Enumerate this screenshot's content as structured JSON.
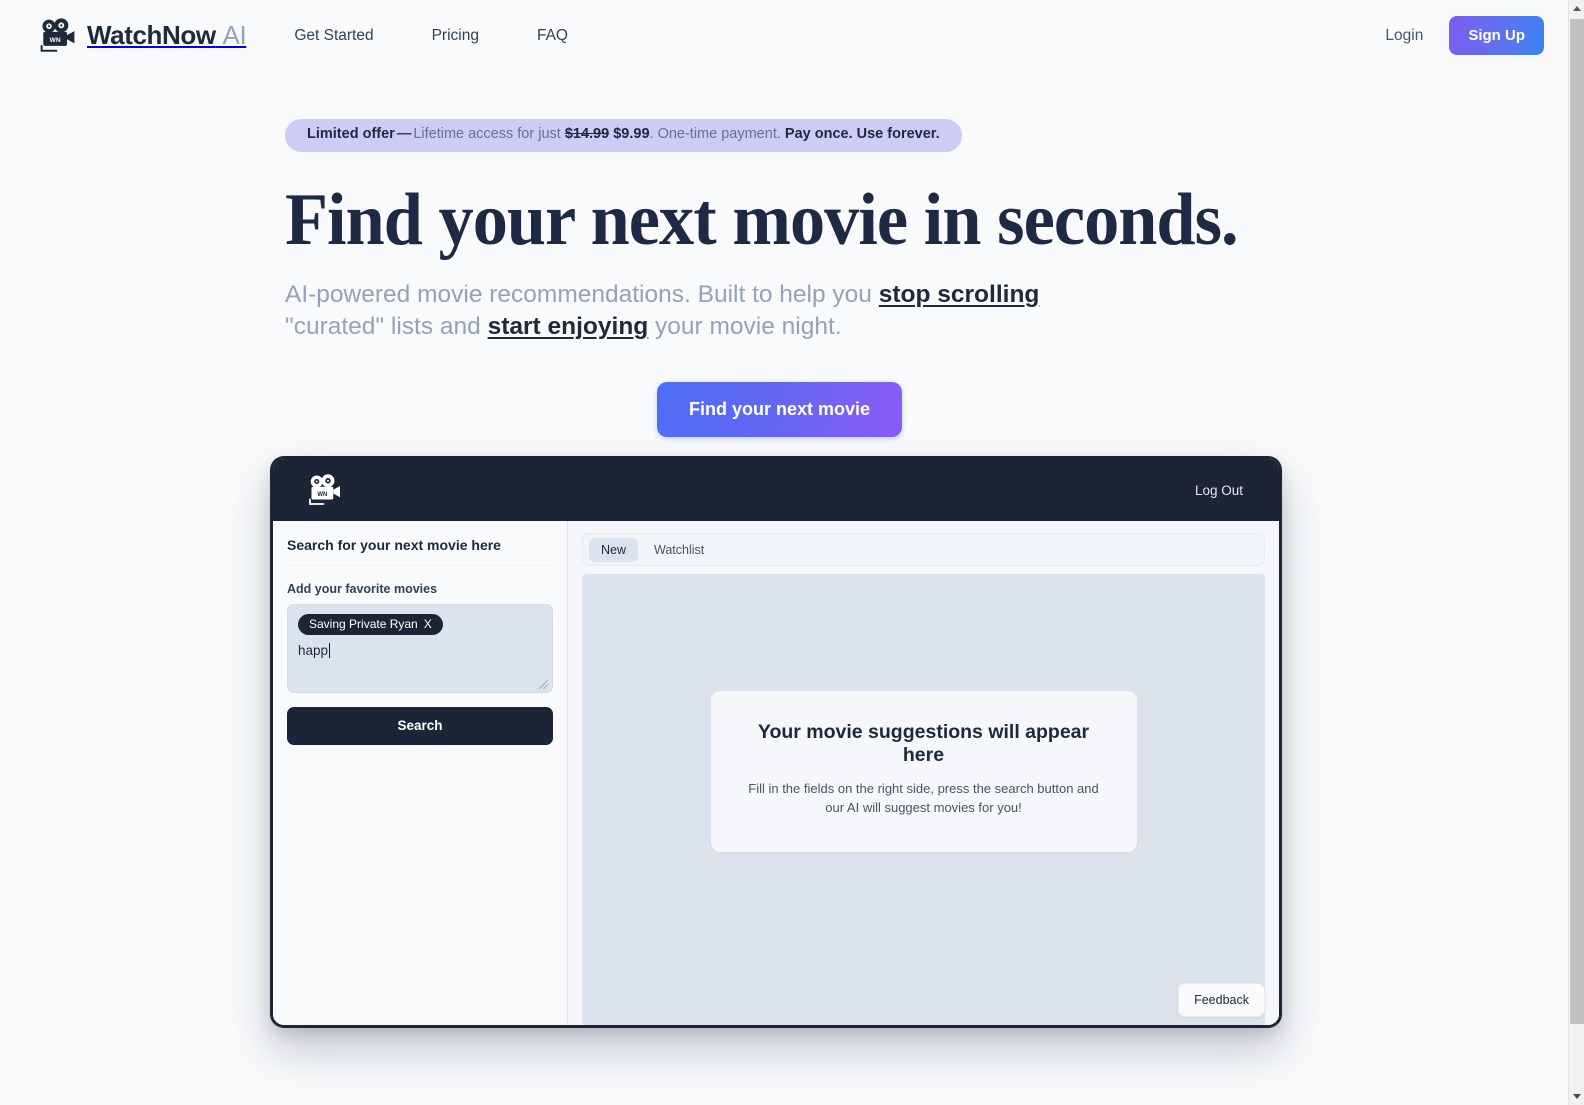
{
  "nav": {
    "brand_name": "WatchNow",
    "brand_suffix": "AI",
    "logo_icon": "movie-camera-icon",
    "links": [
      {
        "label": "Get Started"
      },
      {
        "label": "Pricing"
      },
      {
        "label": "FAQ"
      }
    ],
    "login_label": "Login",
    "signup_label": "Sign Up",
    "signup_gradient_from": "#7c5cf0",
    "signup_gradient_to": "#3b82f6"
  },
  "hero": {
    "banner": {
      "lead": "Limited offer",
      "dash": "—",
      "text_before": "Lifetime access for just",
      "old_price": "$14.99",
      "new_price": "$9.99",
      "text_middle": ". One-time payment.",
      "emphasis": "Pay once. Use forever.",
      "background": "#ccccf7"
    },
    "headline": "Find your next movie in seconds.",
    "subhead": {
      "part1": "AI-powered movie recommendations. Built to help you ",
      "accent1": "stop scrolling",
      "part2": " \"curated\" lists and ",
      "accent2": "start enjoying",
      "part3": " your movie night."
    },
    "cta_label": "Find your next movie",
    "cta_gradient_from": "#4f6ef7",
    "cta_gradient_to": "#8b5cf6"
  },
  "app_preview": {
    "header": {
      "logo_icon": "movie-camera-icon",
      "logout_label": "Log Out",
      "background": "#1c2536"
    },
    "sidebar": {
      "title": "Search for your next movie here",
      "field_label": "Add your favorite movies",
      "chips": [
        {
          "label": "Saving Private Ryan",
          "remove_label": "X"
        }
      ],
      "typed_value": "happ",
      "search_button_label": "Search"
    },
    "main": {
      "tabs": [
        {
          "label": "New",
          "active": true
        },
        {
          "label": "Watchlist",
          "active": false
        }
      ],
      "placeholder_title": "Your movie suggestions will appear here",
      "placeholder_subtitle": "Fill in the fields on the right side, press the search button and our AI will suggest movies for you!",
      "feedback_label": "Feedback",
      "results_background": "#dde3ec"
    }
  }
}
